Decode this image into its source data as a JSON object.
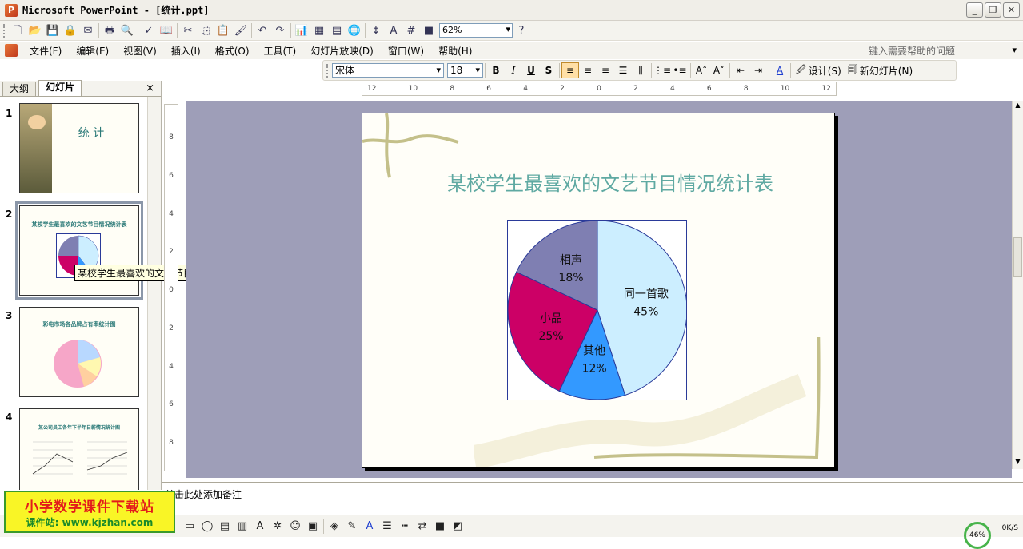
{
  "window": {
    "title": "Microsoft PowerPoint - [统计.ppt]",
    "min": "_",
    "restore": "❐",
    "close": "✕"
  },
  "toolbar": {
    "zoom": "62%"
  },
  "menubar": {
    "items": [
      "文件(F)",
      "编辑(E)",
      "视图(V)",
      "插入(I)",
      "格式(O)",
      "工具(T)",
      "幻灯片放映(D)",
      "窗口(W)",
      "帮助(H)"
    ],
    "help_placeholder": "键入需要帮助的问题"
  },
  "format_toolbar": {
    "font": "宋体",
    "size": "18",
    "bold": "B",
    "italic": "I",
    "underline": "U",
    "shadow": "S",
    "design": "设计(S)",
    "new_slide": "新幻灯片(N)"
  },
  "pane": {
    "tabs": [
      "大纲",
      "幻灯片"
    ],
    "close": "×",
    "slides": [
      {
        "num": "1",
        "title": "统 计"
      },
      {
        "num": "2",
        "title": "某校学生最喜欢的文艺节目情况统计表"
      },
      {
        "num": "3",
        "title": "彩电市场各品牌占有率统计图"
      },
      {
        "num": "4",
        "title": "某公司员工各年下半年日薪情况统计图"
      }
    ],
    "tooltip": "某校学生最喜欢的文艺节目情..."
  },
  "ruler": {
    "h_ticks": [
      "12",
      "10",
      "8",
      "6",
      "4",
      "2",
      "0",
      "2",
      "4",
      "6",
      "8",
      "10",
      "12"
    ],
    "v_ticks": [
      "8",
      "6",
      "4",
      "2",
      "0",
      "2",
      "4",
      "6",
      "8"
    ]
  },
  "slide": {
    "title": "某校学生最喜欢的文艺节目情况统计表"
  },
  "chart_data": {
    "type": "pie",
    "title": "",
    "series": [
      {
        "name": "同一首歌",
        "value": 45,
        "label": "45%",
        "color": "#cceeff"
      },
      {
        "name": "其他",
        "value": 12,
        "label": "12%",
        "color": "#3399ff"
      },
      {
        "name": "小品",
        "value": 25,
        "label": "25%",
        "color": "#cc0066"
      },
      {
        "name": "相声",
        "value": 18,
        "label": "18%",
        "color": "#7f7fb2"
      }
    ]
  },
  "notes": {
    "placeholder": "单击此处添加备注"
  },
  "brand": {
    "title": "小学数学课件下载站",
    "sub": "课件站: www.kjzhan.com"
  },
  "status": {
    "net": "0K/S",
    "ring": "46%"
  },
  "colors": {
    "editor_bg": "#9e9eb8",
    "title_color": "#5fa9a2",
    "chart_border": "#2a3a99"
  }
}
